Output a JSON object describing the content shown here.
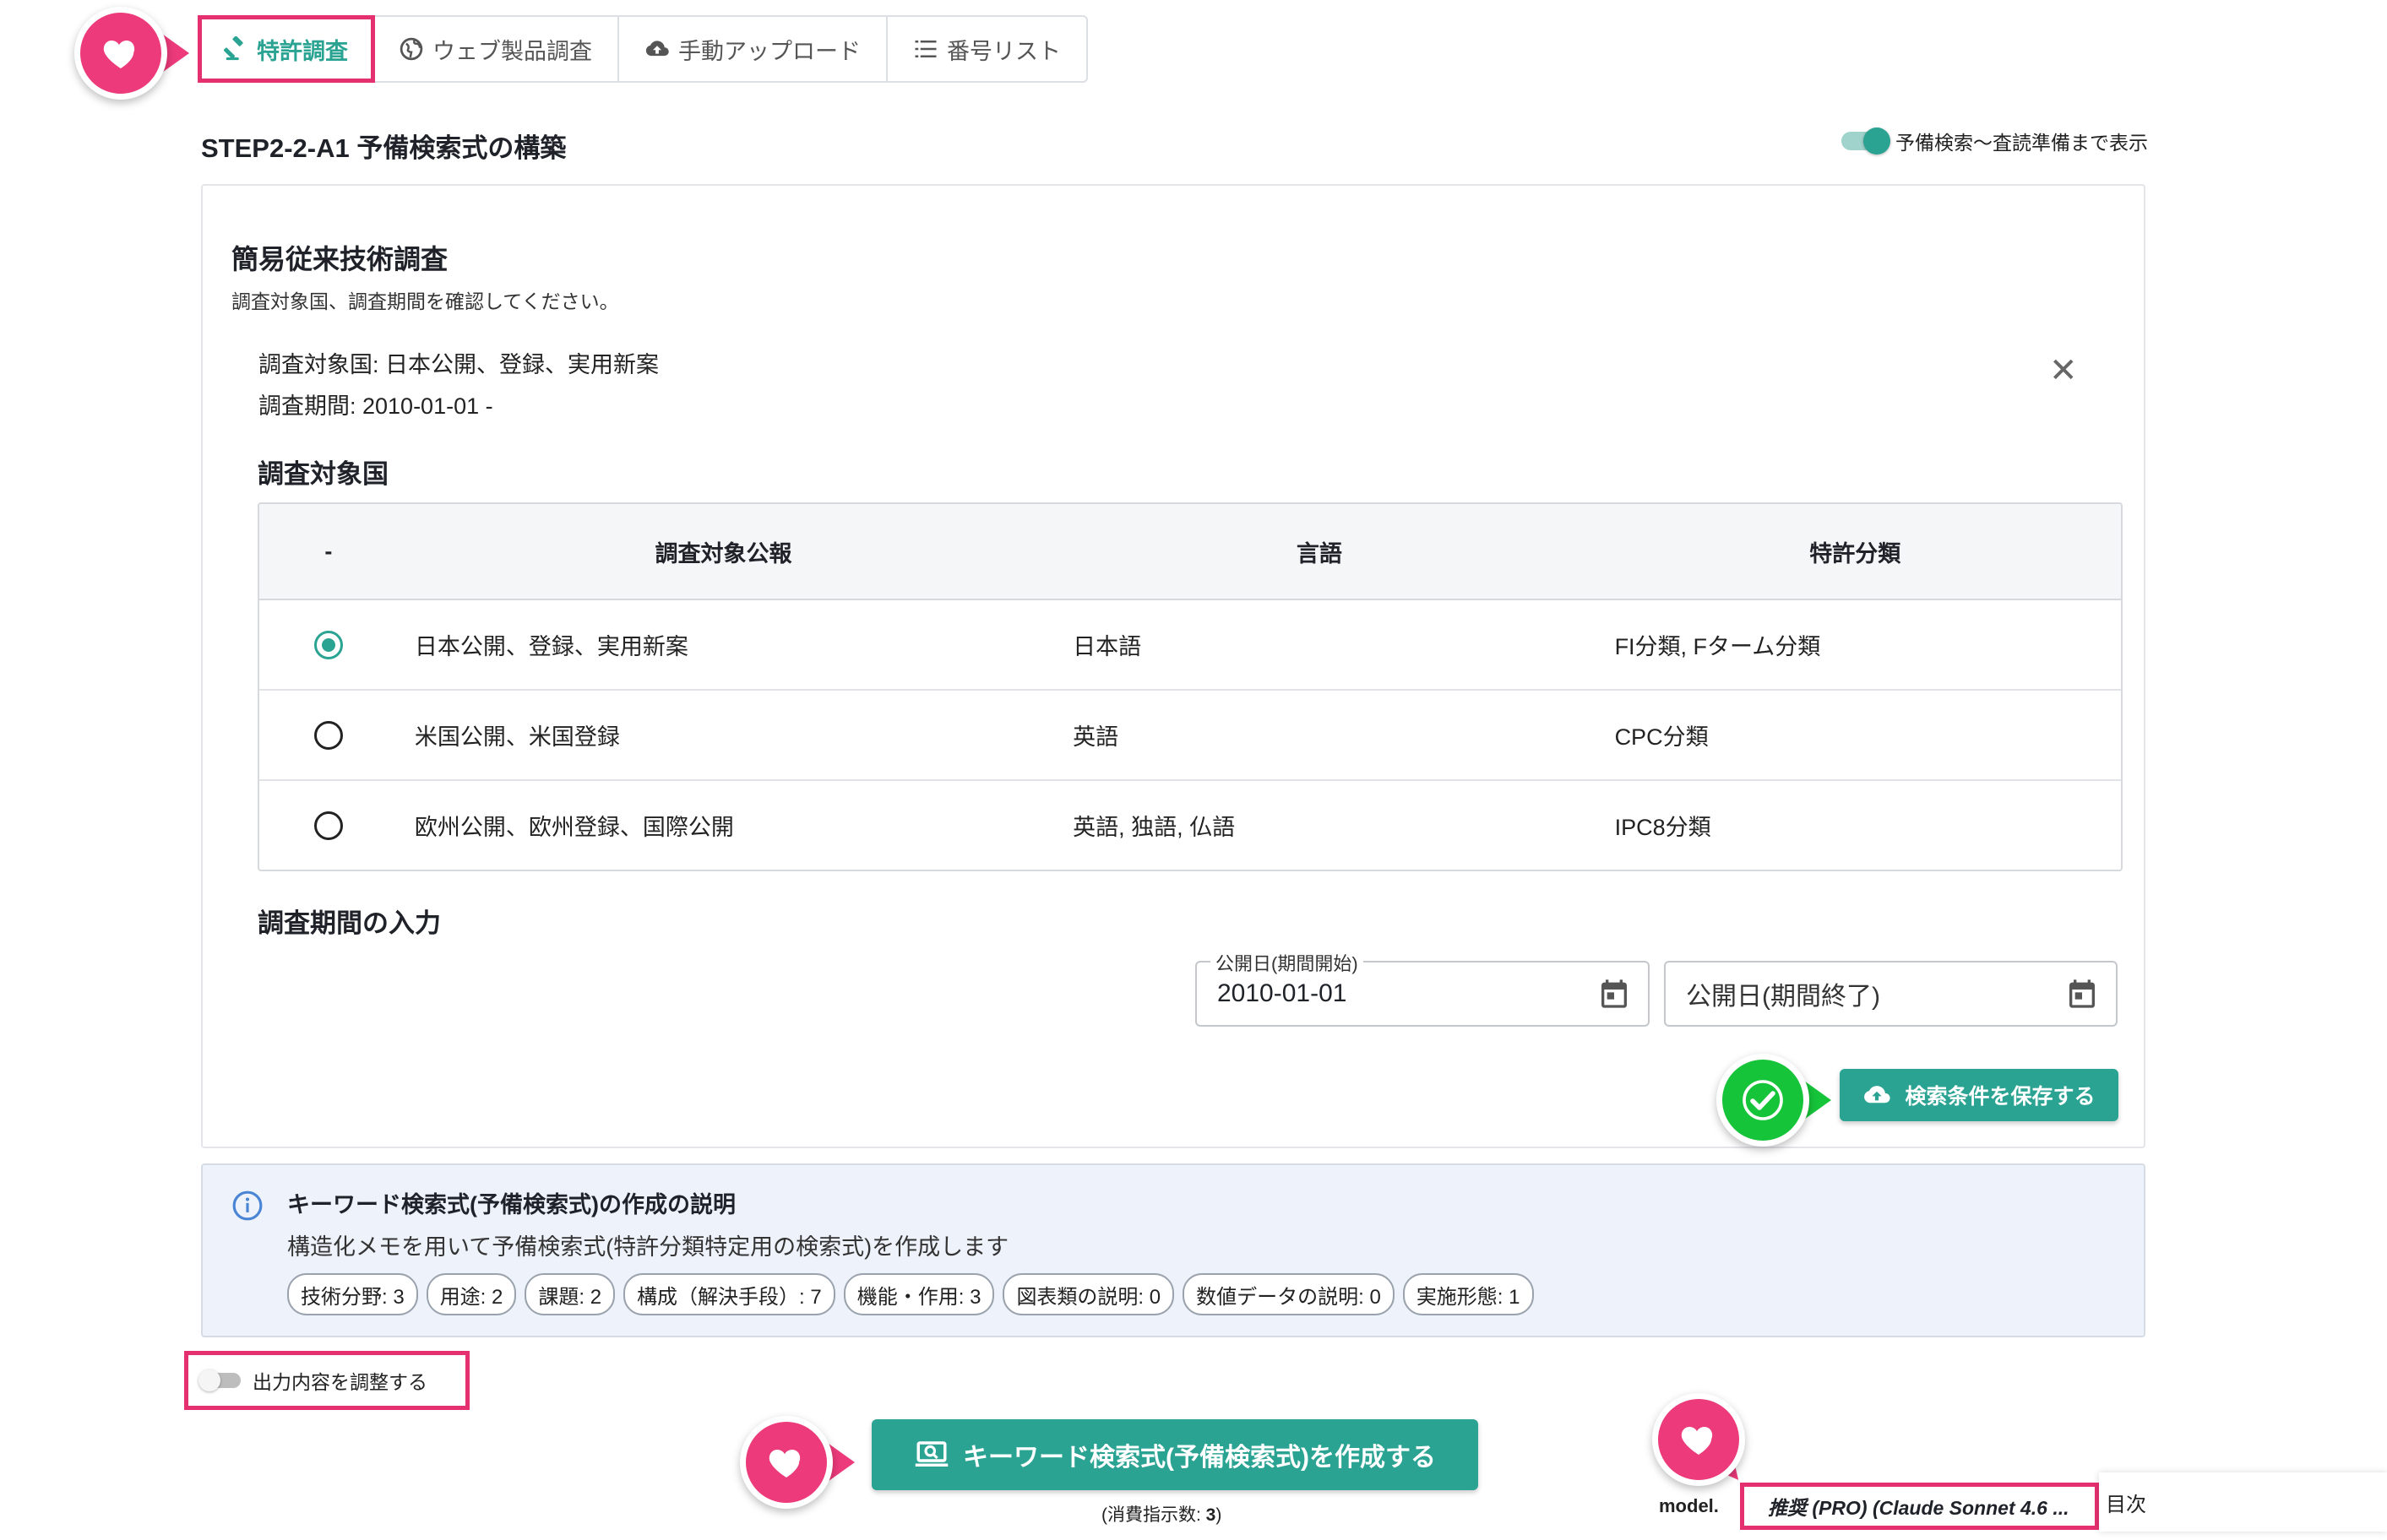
{
  "tabs": [
    {
      "label": "特許調査",
      "icon": "gavel-icon",
      "active": true
    },
    {
      "label": "ウェブ製品調査",
      "icon": "globe-icon"
    },
    {
      "label": "手動アップロード",
      "icon": "cloud-upload-icon"
    },
    {
      "label": "番号リスト",
      "icon": "list-icon"
    }
  ],
  "step_title": "STEP2-2-A1 予備検索式の構築",
  "toggle_label": "予備検索〜査読準備まで表示",
  "section": {
    "title": "簡易従来技術調査",
    "description": "調査対象国、調査期間を確認してください。",
    "summary_country": "調査対象国: 日本公開、登録、実用新案",
    "summary_period": "調査期間: 2010-01-01 -"
  },
  "country_section_title": "調査対象国",
  "table": {
    "headers": [
      "-",
      "調査対象公報",
      "言語",
      "特許分類"
    ],
    "rows": [
      {
        "publication": "日本公開、登録、実用新案",
        "language": "日本語",
        "classification": "FI分類, Fターム分類",
        "selected": true
      },
      {
        "publication": "米国公開、米国登録",
        "language": "英語",
        "classification": "CPC分類",
        "selected": false
      },
      {
        "publication": "欧州公開、欧州登録、国際公開",
        "language": "英語, 独語, 仏語",
        "classification": "IPC8分類",
        "selected": false
      }
    ]
  },
  "period_section_title": "調査期間の入力",
  "date_start": {
    "label": "公開日(期間開始)",
    "value": "2010-01-01"
  },
  "date_end": {
    "placeholder": "公開日(期間終了)"
  },
  "save_button": "検索条件を保存する",
  "info": {
    "title": "キーワード検索式(予備検索式)の作成の説明",
    "description": "構造化メモを用いて予備検索式(特許分類特定用の検索式)を作成します",
    "chips": [
      "技術分野: 3",
      "用途: 2",
      "課題: 2",
      "構成（解決手段）: 7",
      "機能・作用: 3",
      "図表類の説明: 0",
      "数値データの説明: 0",
      "実施形態: 1"
    ]
  },
  "adjust_toggle_label": "出力内容を調整する",
  "create_button": "キーワード検索式(予備検索式)を作成する",
  "consumption_label": "(消費指示数: ",
  "consumption_value": "3",
  "consumption_suffix": ")",
  "model_label": "model.",
  "model_value": "推奨 (PRO) (Claude Sonnet 4.6 ...",
  "toc_label": "目次",
  "colors": {
    "accent": "#2aa392",
    "highlight": "#e5306f",
    "heart": "#ec3a7a",
    "check": "#16c43a"
  }
}
